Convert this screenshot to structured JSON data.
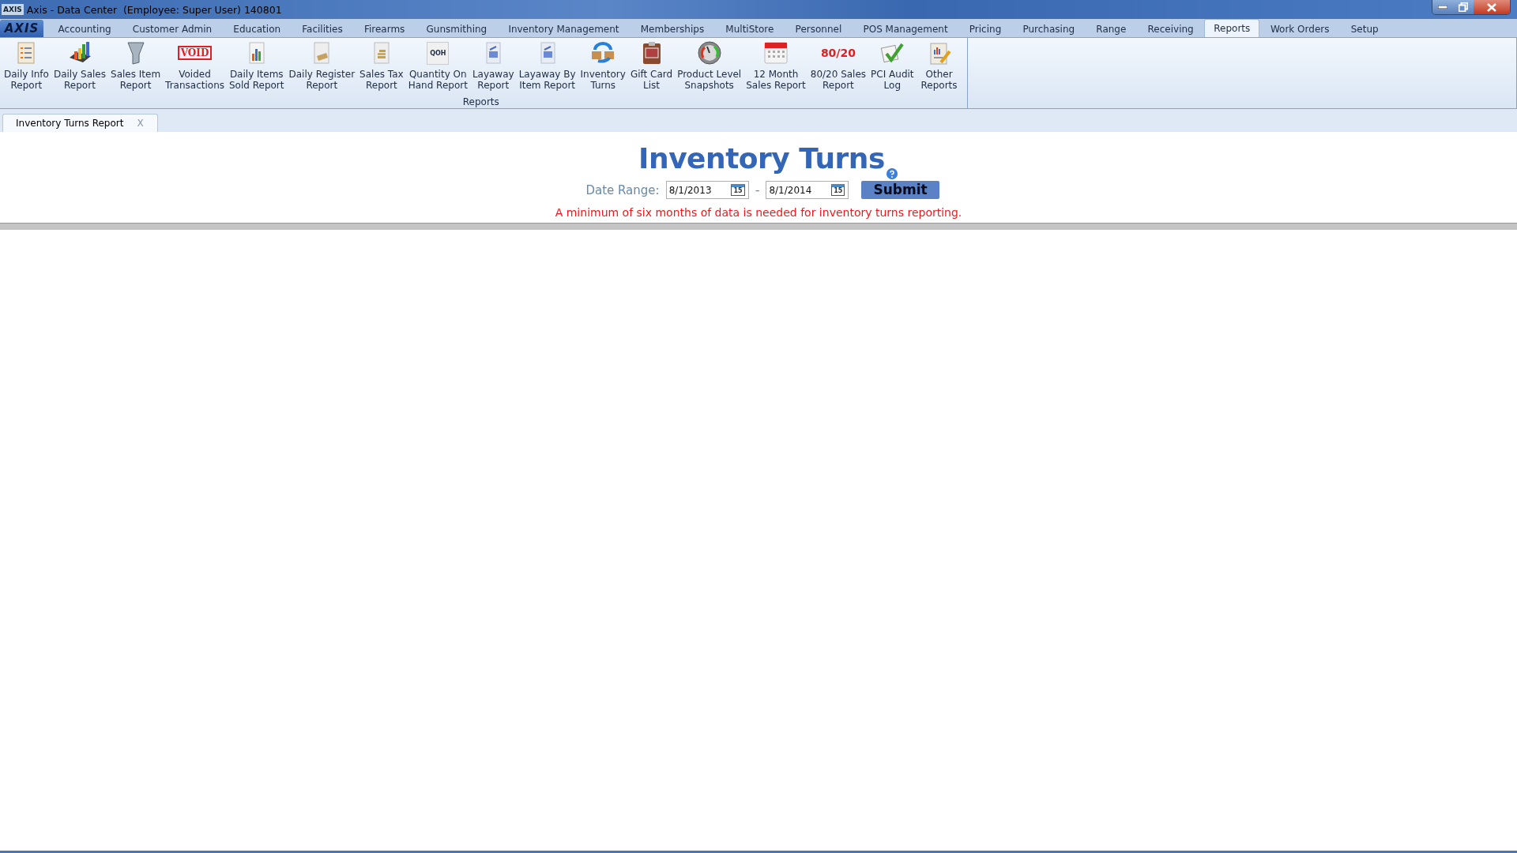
{
  "window": {
    "title": "Axis - Data Center  (Employee: Super User) 140801",
    "app_badge": "AXIS"
  },
  "menu": {
    "logo": "AXIS",
    "tabs": [
      {
        "label": "Accounting",
        "selected": false
      },
      {
        "label": "Customer Admin",
        "selected": false
      },
      {
        "label": "Education",
        "selected": false
      },
      {
        "label": "Facilities",
        "selected": false
      },
      {
        "label": "Firearms",
        "selected": false
      },
      {
        "label": "Gunsmithing",
        "selected": false
      },
      {
        "label": "Inventory Management",
        "selected": false
      },
      {
        "label": "Memberships",
        "selected": false
      },
      {
        "label": "MultiStore",
        "selected": false
      },
      {
        "label": "Personnel",
        "selected": false
      },
      {
        "label": "POS Management",
        "selected": false
      },
      {
        "label": "Pricing",
        "selected": false
      },
      {
        "label": "Purchasing",
        "selected": false
      },
      {
        "label": "Range",
        "selected": false
      },
      {
        "label": "Receiving",
        "selected": false
      },
      {
        "label": "Reports",
        "selected": true
      },
      {
        "label": "Work Orders",
        "selected": false
      },
      {
        "label": "Setup",
        "selected": false
      }
    ]
  },
  "ribbon": {
    "group_label": "Reports",
    "buttons": [
      {
        "label": "Daily Info\nReport"
      },
      {
        "label": "Daily Sales\nReport"
      },
      {
        "label": "Sales Item\nReport"
      },
      {
        "label": "Voided\nTransactions",
        "icon_text": "VOID"
      },
      {
        "label": "Daily Items\nSold Report"
      },
      {
        "label": "Daily Register\nReport"
      },
      {
        "label": "Sales Tax\nReport"
      },
      {
        "label": "Quantity On\nHand Report",
        "icon_text": "QOH"
      },
      {
        "label": "Layaway\nReport"
      },
      {
        "label": "Layaway By\nItem Report"
      },
      {
        "label": "Inventory\nTurns"
      },
      {
        "label": "Gift Card\nList"
      },
      {
        "label": "Product Level\nSnapshots"
      },
      {
        "label": "12 Month\nSales Report"
      },
      {
        "label": "80/20 Sales\nReport",
        "icon_text": "80/20"
      },
      {
        "label": "PCI Audit\nLog"
      },
      {
        "label": "Other\nReports"
      }
    ]
  },
  "document_tabs": [
    {
      "label": "Inventory Turns Report",
      "close": "X",
      "selected": true
    }
  ],
  "report": {
    "title": "Inventory Turns",
    "date_range_label": "Date Range:",
    "start_date": "8/1/2013",
    "separator": "-",
    "start_calendar_day": "15",
    "end_date": "8/1/2014",
    "end_calendar_day": "15",
    "submit": "Submit",
    "message": "A minimum of six months of data is needed for inventory turns reporting."
  }
}
